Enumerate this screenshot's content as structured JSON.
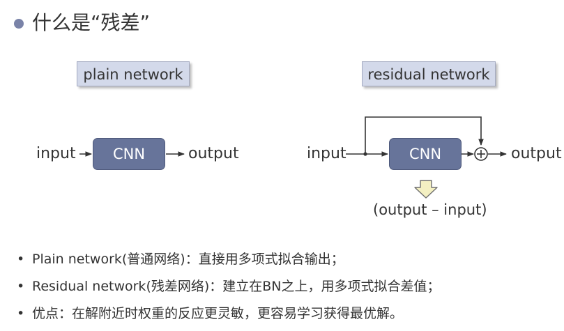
{
  "title": "什么是“残差”",
  "plain": {
    "label": "plain network",
    "input": "input",
    "cnn": "CNN",
    "output": "output"
  },
  "residual": {
    "label": "residual network",
    "input": "input",
    "cnn": "CNN",
    "output": "output",
    "difference": "(output – input)"
  },
  "bullets": [
    "Plain network(普通网络)：直接用多项式拟合输出；",
    "Residual network(残差网络)：建立在BN之上，用多项式拟合差值；",
    "优点：在解附近时权重的反应更灵敏，更容易学习获得最优解。"
  ],
  "bullet_marker": "•",
  "colors": {
    "cnn_fill": "#67749a",
    "label_fill": "#d3d9ea",
    "title_dot": "#7a83a8",
    "arrow_fill": "#f4f0c2"
  }
}
